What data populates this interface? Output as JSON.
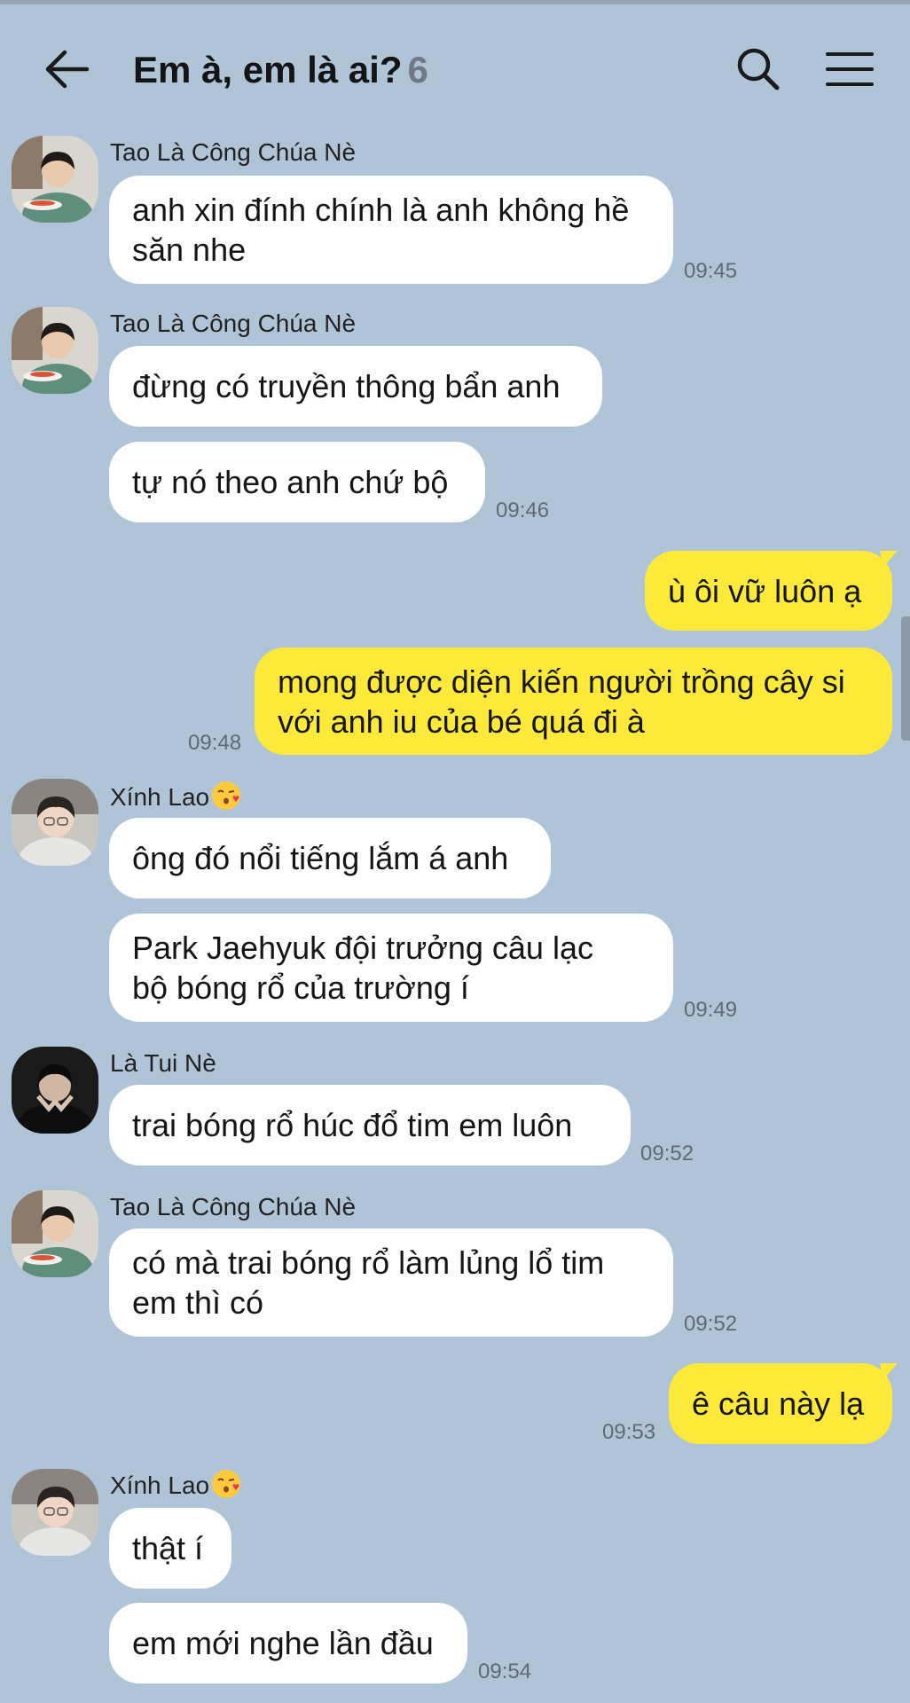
{
  "header": {
    "title": "Em à, em là ai?",
    "member_count": "6",
    "back_icon": "arrow-left-icon",
    "search_icon": "search-icon",
    "menu_icon": "hamburger-menu-icon"
  },
  "colors": {
    "background": "#b0c4d8",
    "incoming_bubble": "#ffffff",
    "outgoing_bubble": "#fde93a"
  },
  "messages": {
    "m1": {
      "sender": "Tao Là Công Chúa Nè",
      "text": "anh xin đính chính là anh không hề\nsăn nhe",
      "time": "09:45"
    },
    "m2": {
      "sender": "Tao Là Công Chúa Nè",
      "text": "đừng có truyền thông bẩn anh"
    },
    "m3": {
      "text": "tự nó theo anh chứ bộ",
      "time": "09:46"
    },
    "m4": {
      "text": "ù ôi vữ luôn ạ"
    },
    "m5": {
      "text": "mong được diện kiến người trồng cây si\nvới anh iu của bé quá đi à",
      "time": "09:48"
    },
    "m6": {
      "sender": "Xính Lao",
      "text": "ông đó nổi tiếng lắm á anh"
    },
    "m7": {
      "text": "Park Jaehyuk đội trưởng câu lạc\nbộ bóng rổ của trường í",
      "time": "09:49"
    },
    "m8": {
      "sender": "Là Tui Nè",
      "text": "trai bóng rổ húc đổ tim em luôn",
      "time": "09:52"
    },
    "m9": {
      "sender": "Tao Là Công Chúa Nè",
      "text": "có mà trai bóng rổ làm lủng lổ tim\nem thì có",
      "time": "09:52"
    },
    "m10": {
      "text": "ê câu này lạ",
      "time": "09:53"
    },
    "m11": {
      "sender": "Xính Lao",
      "text": "thật í"
    },
    "m12": {
      "text": "em mới nghe lần đầu",
      "time": "09:54"
    }
  }
}
